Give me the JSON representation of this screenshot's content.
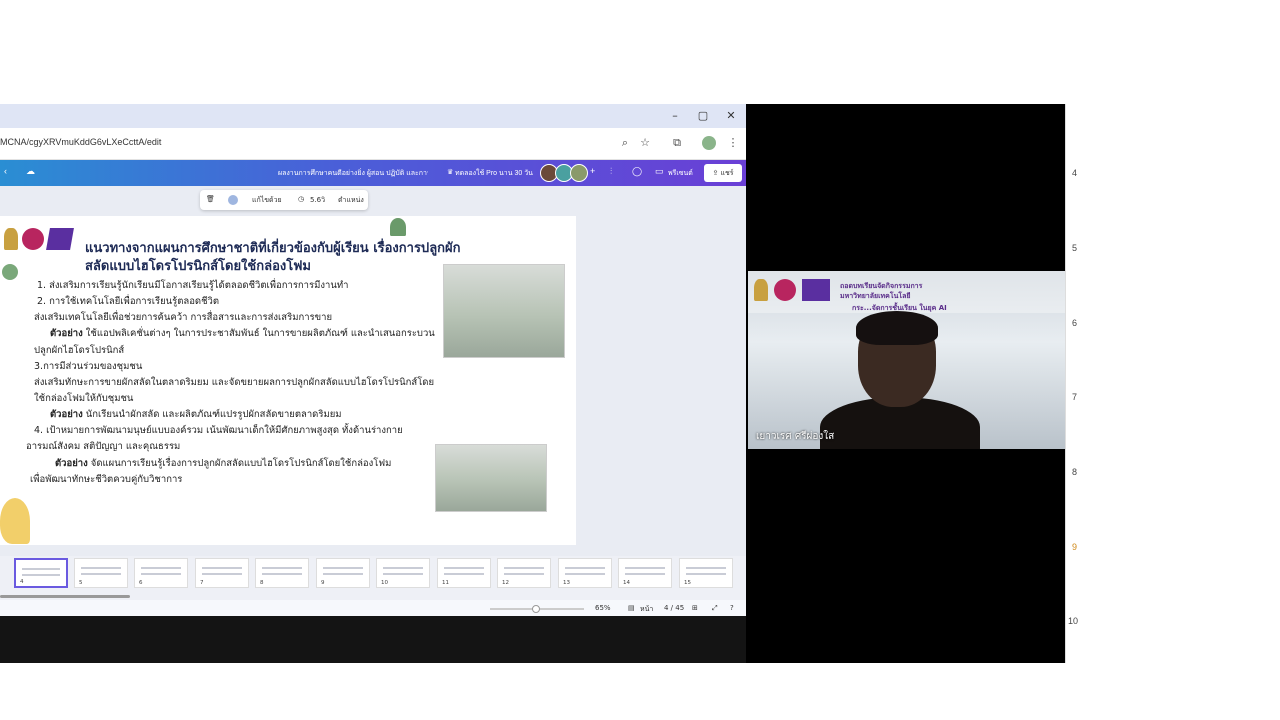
{
  "browser": {
    "url": "MCNA/cgyXRVmuKddG6vLXeCcttA/edit",
    "window_controls": [
      "–",
      "▢",
      "✕"
    ]
  },
  "canva": {
    "doc_title": "ผลงานการศึกษาคนดีอย่างยิ่ง ผู้สอน ปฏิบัติ และการศึกษาพิเศษ",
    "pro_offer": "ทดลองใช้ Pro นาน 30 วัน",
    "present_label": "พรีเซนต์",
    "share_label": "แชร์"
  },
  "float_toolbar": {
    "ai_label": "แก้ไขด้วย",
    "timer": "5.6วิ",
    "position_label": "ตำแหน่ง"
  },
  "slide": {
    "title_line1": "แนวทางจากแผนการศึกษาชาติที่เกี่ยวข้องกับผู้เรียน เรื่องการปลูกผัก",
    "title_line2": "สลัดแบบไฮโดรโปรนิกส์โดยใช้กล่องโฟม",
    "lines": [
      "1.  ส่งเสริมการเรียนรู้นักเรียนมีโอกาสเรียนรู้ได้ตลอดชีวิตเพื่อการการมีงานทำ",
      "2.  การใช้เทคโนโลยีเพื่อการเรียนรู้ตลอดชีวิต",
      "ส่งเสริมเทคโนโลยีเพื่อช่วยการค้นคว้า การสื่อสารและการส่งเสริมการขาย",
      "ใช้แอปพลิเคชั่นต่างๆ ในการประชาสัมพันธ์ ในการขายผลิตภัณฑ์ และนำเสนอกระบวน",
      "ปลูกผักไฮโดรโปรนิกส์",
      "3.การมีส่วนร่วมของชุมชน",
      "ส่งเสริมทักษะการขายผักสลัดในตลาดริมยม และจัดขยายผลการปลูกผักสลัดแบบไฮโดรโปรนิกส์โดย",
      "ใช้กล่องโฟมให้กับชุมชน",
      "นักเรียนนำผักสลัด และผลิตภัณฑ์แปรรูปผักสลัดขายตลาดริมยม",
      "4.  เป้าหมายการพัฒนามนุษย์แบบองค์รวม เน้นพัฒนาเด็กให้มีศักยภาพสูงสุด ทั้งด้านร่างกาย",
      "อารมณ์สังคม สติปัญญา และคุณธรรม",
      "จัดแผนการเรียนรู้เรื่องการปลูกผักสลัดแบบไฮโดรโปรนิกส์โดยใช้กล่องโฟม",
      "เพื่อพัฒนาทักษะชีวิตควบคู่กับวิชาการ"
    ],
    "example_label": "ตัวอย่าง"
  },
  "thumbnails": [
    "4",
    "5",
    "6",
    "7",
    "8",
    "9",
    "10",
    "11",
    "12",
    "13",
    "14",
    "15"
  ],
  "status": {
    "zoom": "65%",
    "view_label": "หน้า",
    "page_counter": "4 / 45"
  },
  "video": {
    "banner_line1": "ถอดบทเรียนจัดกิจกรรมการ",
    "banner_line2": "มหาวิทยาลัยเทคโนโลยี",
    "banner_line3": "กระ...จัดการชั้นเรียน ในยุค AI",
    "participant_name": "เยาวเรศ ศรีผ่องใส"
  },
  "edge_numbers": [
    "4",
    "5",
    "6",
    "7",
    "8",
    "9",
    "10"
  ],
  "colors": {
    "canva_gradient_start": "#2a8ed3",
    "canva_gradient_end": "#6a3fd6",
    "title_color": "#1d2a55"
  }
}
